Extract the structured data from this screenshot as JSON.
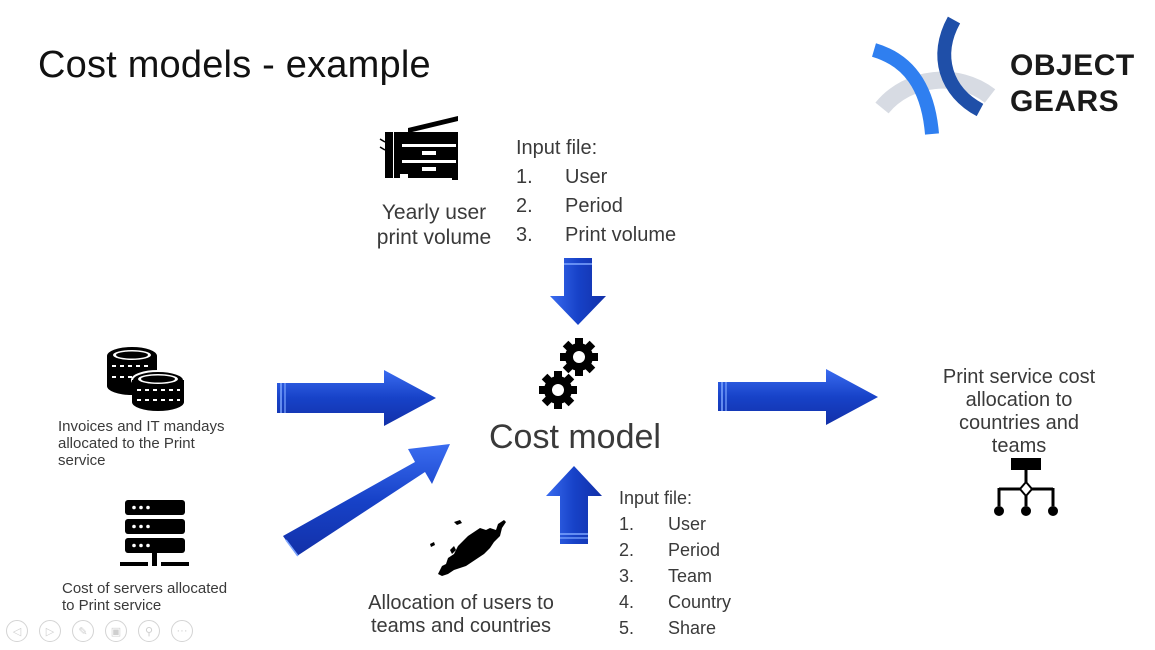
{
  "slide": {
    "title": "Cost models - example",
    "brand": {
      "line1": "OBJECT",
      "line2": "GEARS",
      "colors": {
        "blue_light": "#2f7ff0",
        "blue_dark": "#1f4fa8",
        "grey_arc": "#d7dbe3"
      }
    },
    "accent_color": "#1742c8"
  },
  "print_volume": {
    "icon": "printer-icon",
    "label_line1": "Yearly user",
    "label_line2": "print volume",
    "input": {
      "header": "Input file:",
      "items": [
        {
          "num": "1.",
          "text": "User"
        },
        {
          "num": "2.",
          "text": "Period"
        },
        {
          "num": "3.",
          "text": "Print volume"
        }
      ]
    }
  },
  "invoices": {
    "icon": "coins-icon",
    "label_line1": "Invoices and IT mandays",
    "label_line2": "allocated to the Print",
    "label_line3": "service"
  },
  "servers": {
    "icon": "server-icon",
    "label_line1": "Cost of servers allocated",
    "label_line2": "to Print service"
  },
  "cost_model": {
    "icon": "gears-icon",
    "label": "Cost model"
  },
  "allocation": {
    "icon": "europe-map-icon",
    "label_line1": "Allocation of users to",
    "label_line2": "teams and countries",
    "input": {
      "header": "Input file:",
      "items": [
        {
          "num": "1.",
          "text": "User"
        },
        {
          "num": "2.",
          "text": "Period"
        },
        {
          "num": "3.",
          "text": "Team"
        },
        {
          "num": "4.",
          "text": "Country"
        },
        {
          "num": "5.",
          "text": "Share"
        }
      ]
    }
  },
  "output": {
    "icon": "hierarchy-icon",
    "label_lines": [
      "Print service cost",
      "allocation to",
      "countries and",
      "teams"
    ]
  },
  "nav_controls": [
    {
      "icon": "previous-icon",
      "glyph": "◁"
    },
    {
      "icon": "next-icon",
      "glyph": "▷"
    },
    {
      "icon": "pen-icon",
      "glyph": "✎"
    },
    {
      "icon": "slides-icon",
      "glyph": "▣"
    },
    {
      "icon": "zoom-icon",
      "glyph": "⚲"
    },
    {
      "icon": "more-icon",
      "glyph": "···"
    }
  ]
}
